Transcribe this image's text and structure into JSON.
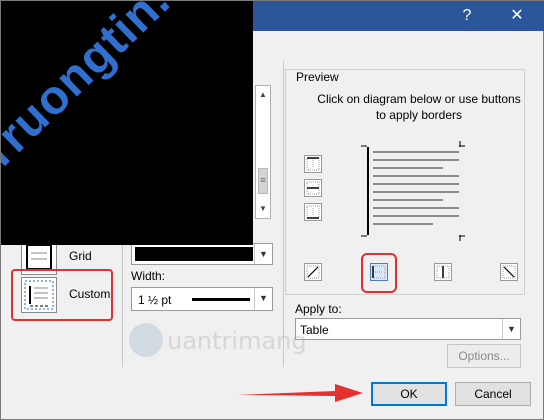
{
  "window": {
    "help_glyph": "?",
    "close_glyph": "✕",
    "titlebar_color": "#2b579a"
  },
  "watermark": {
    "text": "Truongtin.top",
    "color": "#2f6fcf"
  },
  "setting": {
    "items": [
      {
        "label": "Grid",
        "icon": "grid-setting-icon"
      },
      {
        "label": "Custom",
        "icon": "custom-setting-icon",
        "selected": true
      }
    ]
  },
  "style": {
    "color_value": "#000000",
    "width_label": "Width:",
    "width_value": "1 ½ pt"
  },
  "preview": {
    "title": "Preview",
    "instruction": "Click on diagram below or use buttons to apply borders",
    "border_buttons_left": [
      "top-border-icon",
      "inside-horizontal-border-icon",
      "bottom-border-icon"
    ],
    "border_buttons_bottom": [
      "diagonal-up-border-icon",
      "left-border-icon",
      "inside-vertical-border-icon",
      "diagonal-down-border-icon"
    ],
    "highlighted_button": "left-border-icon"
  },
  "apply": {
    "label": "Apply to:",
    "value": "Table",
    "options_label": "Options..."
  },
  "footer": {
    "ok_label": "OK",
    "cancel_label": "Cancel"
  },
  "logo_watermark": {
    "text": "uantrimang"
  },
  "annotation_color": "#e03030"
}
